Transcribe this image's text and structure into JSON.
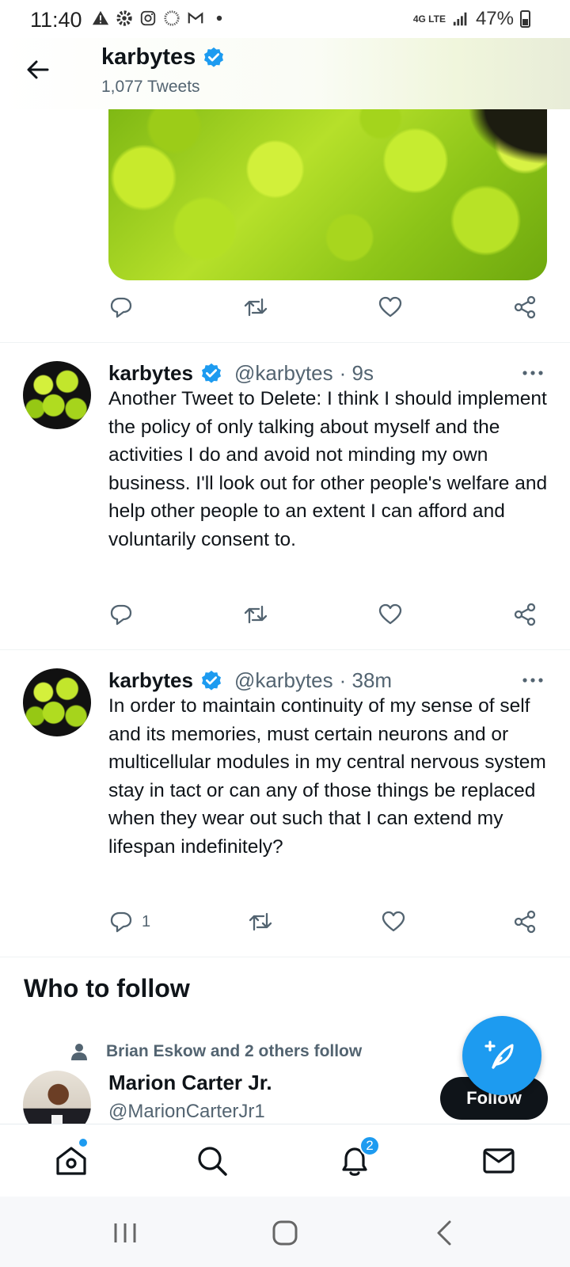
{
  "status_bar": {
    "time": "11:40",
    "network": "4G LTE",
    "battery": "47%"
  },
  "header": {
    "name": "karbytes",
    "tweet_count": "1,077 Tweets"
  },
  "tweets": [
    {
      "name": "karbytes",
      "handle": "@karbytes",
      "time": "· 9s",
      "text": "Another Tweet to Delete: I think I should implement the policy of only talking about myself and the activities I do and avoid not minding my own business. I'll look out for other people's welfare and help other people to an extent I can afford and voluntarily consent to.",
      "reply_count": ""
    },
    {
      "name": "karbytes",
      "handle": "@karbytes",
      "time": "· 38m",
      "text": "In order to maintain continuity of my sense of self and its memories, must certain neurons and or multicellular modules in my central nervous system stay in tact or can any of those things be replaced when they wear out such that I can extend my lifespan indefinitely?",
      "reply_count": "1"
    }
  ],
  "who_to_follow": {
    "title": "Who to follow",
    "social_context": "Brian Eskow and 2 others follow",
    "name": "Marion Carter Jr.",
    "handle": "@MarionCarterJr1",
    "follow_label": "Follow"
  },
  "bottom_nav": {
    "notifications_badge": "2"
  },
  "colors": {
    "accent": "#1d9bf0",
    "text": "#0f1419",
    "secondary": "#536471"
  }
}
